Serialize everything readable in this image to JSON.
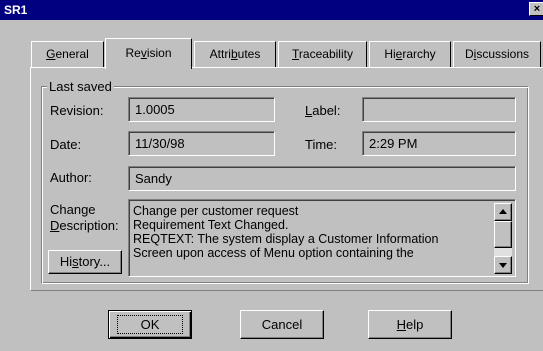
{
  "window": {
    "title": "SR1",
    "close_glyph": "×"
  },
  "tabs": {
    "general": {
      "pre": "",
      "key": "G",
      "post": "eneral"
    },
    "revision": {
      "pre": "Re",
      "key": "v",
      "post": "ision"
    },
    "attributes": {
      "pre": "Attri",
      "key": "b",
      "post": "utes"
    },
    "traceability": {
      "pre": "",
      "key": "T",
      "post": "raceability"
    },
    "hierarchy": {
      "pre": "Hi",
      "key": "e",
      "post": "rarchy"
    },
    "discussions": {
      "pre": "D",
      "key": "i",
      "post": "scussions"
    }
  },
  "revision_panel": {
    "group_title": "Last saved",
    "revision_label": "Revision:",
    "revision_value": "1.0005",
    "label_label": {
      "key": "L",
      "post": "abel:"
    },
    "label_value": "",
    "date_label": "Date:",
    "date_value": "11/30/98",
    "time_label": "Time:",
    "time_value": "2:29 PM",
    "author_label": "Author:",
    "author_value": "Sandy",
    "change_label_line1": "Change",
    "change_label_line2": {
      "key": "D",
      "post": "escription:"
    },
    "description_lines": [
      "Change per customer request",
      "Requirement Text Changed.",
      "REQTEXT: The system display a Customer Information",
      "Screen upon access of Menu option containing the"
    ],
    "history_button": {
      "pre": "Hi",
      "key": "s",
      "post": "tory..."
    }
  },
  "footer": {
    "ok_button": "OK",
    "cancel_button": "Cancel",
    "help_button": {
      "key": "H",
      "post": "elp"
    }
  }
}
